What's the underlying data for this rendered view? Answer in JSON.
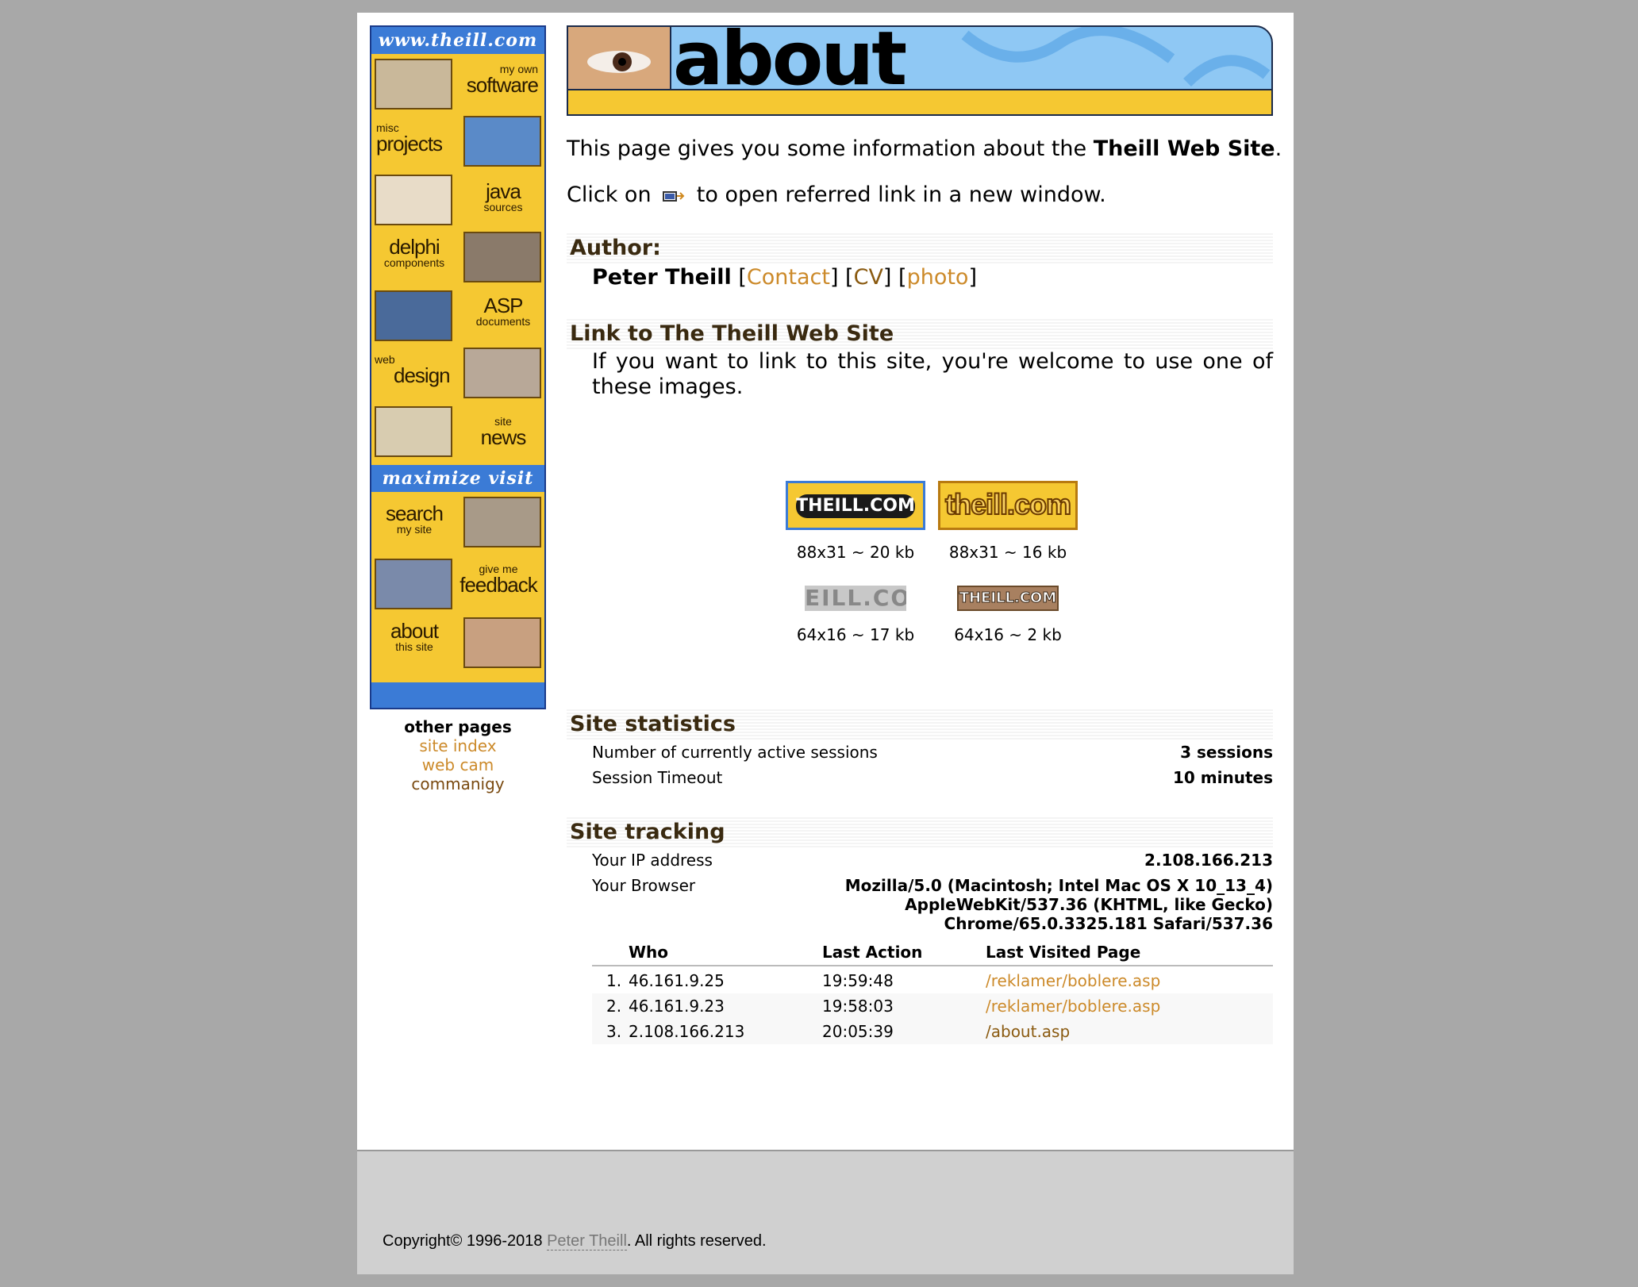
{
  "nav": {
    "banner_top": "www.theill.com",
    "items": [
      {
        "small": "my own",
        "big": "software"
      },
      {
        "small": "misc",
        "big": "projects"
      },
      {
        "small": "sources",
        "big": "java"
      },
      {
        "small": "components",
        "big": "delphi"
      },
      {
        "small": "documents",
        "big": "ASP"
      },
      {
        "small": "web",
        "big": "design"
      },
      {
        "small": "site",
        "big": "news"
      }
    ],
    "banner_mid": "maximize visit",
    "items2": [
      {
        "small": "my site",
        "big": "search"
      },
      {
        "small": "give me",
        "big": "feedback"
      },
      {
        "small": "this site",
        "big": "about"
      }
    ]
  },
  "other_pages": {
    "heading": "other pages",
    "links": [
      "site index",
      "web cam",
      "commanigy"
    ]
  },
  "header": {
    "title": "about"
  },
  "intro": {
    "line1_pre": "This page gives you some information about the ",
    "line1_bold": "Theill Web Site",
    "line1_post": ".",
    "line2_pre": "Click on",
    "line2_post": "to open referred link in a new window."
  },
  "author": {
    "heading": "Author:",
    "name": "Peter Theill",
    "links": [
      "Contact",
      "CV",
      "photo"
    ]
  },
  "link_section": {
    "heading": "Link to The Theill Web Site",
    "text": "If you want to link to this site, you're welcome to use one of these images."
  },
  "badges": [
    {
      "label": "THEILL.COM",
      "caption": "88x31 ~ 20 kb"
    },
    {
      "label": "theill.com",
      "caption": "88x31 ~ 16 kb"
    },
    {
      "label": "EILL.CO",
      "caption": "64x16 ~ 17 kb"
    },
    {
      "label": "THEILL.COM",
      "caption": "64x16 ~ 2 kb"
    }
  ],
  "stats": {
    "heading": "Site statistics",
    "rows": [
      {
        "label": "Number of currently active sessions",
        "value": "3 sessions"
      },
      {
        "label": "Session Timeout",
        "value": "10 minutes"
      }
    ]
  },
  "tracking": {
    "heading": "Site tracking",
    "ip_label": "Your IP address",
    "ip_value": "2.108.166.213",
    "browser_label": "Your Browser",
    "browser_lines": [
      "Mozilla/5.0 (Macintosh; Intel Mac OS X 10_13_4)",
      "AppleWebKit/537.36 (KHTML, like Gecko)",
      "Chrome/65.0.3325.181 Safari/537.36"
    ],
    "columns": [
      "Who",
      "Last Action",
      "Last Visited Page"
    ],
    "rows": [
      {
        "num": "1.",
        "who": "46.161.9.25",
        "time": "19:59:48",
        "page": "/reklamer/boblere.asp"
      },
      {
        "num": "2.",
        "who": "46.161.9.23",
        "time": "19:58:03",
        "page": "/reklamer/boblere.asp"
      },
      {
        "num": "3.",
        "who": "2.108.166.213",
        "time": "20:05:39",
        "page": "/about.asp"
      }
    ]
  },
  "footer": {
    "pre": "Copyright© 1996-2018 ",
    "link": "Peter Theill",
    "post": ". All rights reserved."
  },
  "colors": {
    "link": "#cc8a2a",
    "nav_yellow": "#f5c832",
    "nav_blue": "#3b7bd6"
  }
}
